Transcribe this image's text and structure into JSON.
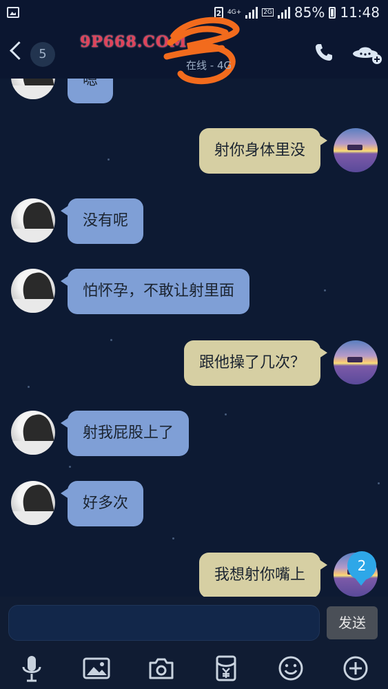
{
  "status_bar": {
    "sim_slot": "2",
    "network_4g": "4G+",
    "network_2g": "2G",
    "battery": "85%",
    "time": "11:48"
  },
  "header": {
    "unread_count": "5",
    "watermark": "9P668.COM",
    "online_status": "在线 - 4G",
    "phone_icon": "phone-icon",
    "more_icon": "ufo-add-icon"
  },
  "messages": [
    {
      "side": "in",
      "text": "嗯"
    },
    {
      "side": "out",
      "text": "射你身体里没"
    },
    {
      "side": "in",
      "text": "没有呢"
    },
    {
      "side": "in",
      "text": "怕怀孕，不敢让射里面"
    },
    {
      "side": "out",
      "text": "跟他操了几次？"
    },
    {
      "side": "in",
      "text": "射我屁股上了"
    },
    {
      "side": "in",
      "text": "好多次"
    },
    {
      "side": "out",
      "text": "我想射你嘴上"
    }
  ],
  "new_message_badge": "2",
  "input": {
    "value": "",
    "placeholder": "",
    "send_label": "发送"
  },
  "toolbar": {
    "items": [
      "mic-icon",
      "image-icon",
      "camera-icon",
      "red-packet-icon",
      "emoji-icon",
      "plus-icon"
    ]
  },
  "colors": {
    "background": "#0d1a33",
    "incoming_bubble": "#7f9fd6",
    "outgoing_bubble": "#d6cfa3",
    "badge": "#2ea7e8"
  }
}
